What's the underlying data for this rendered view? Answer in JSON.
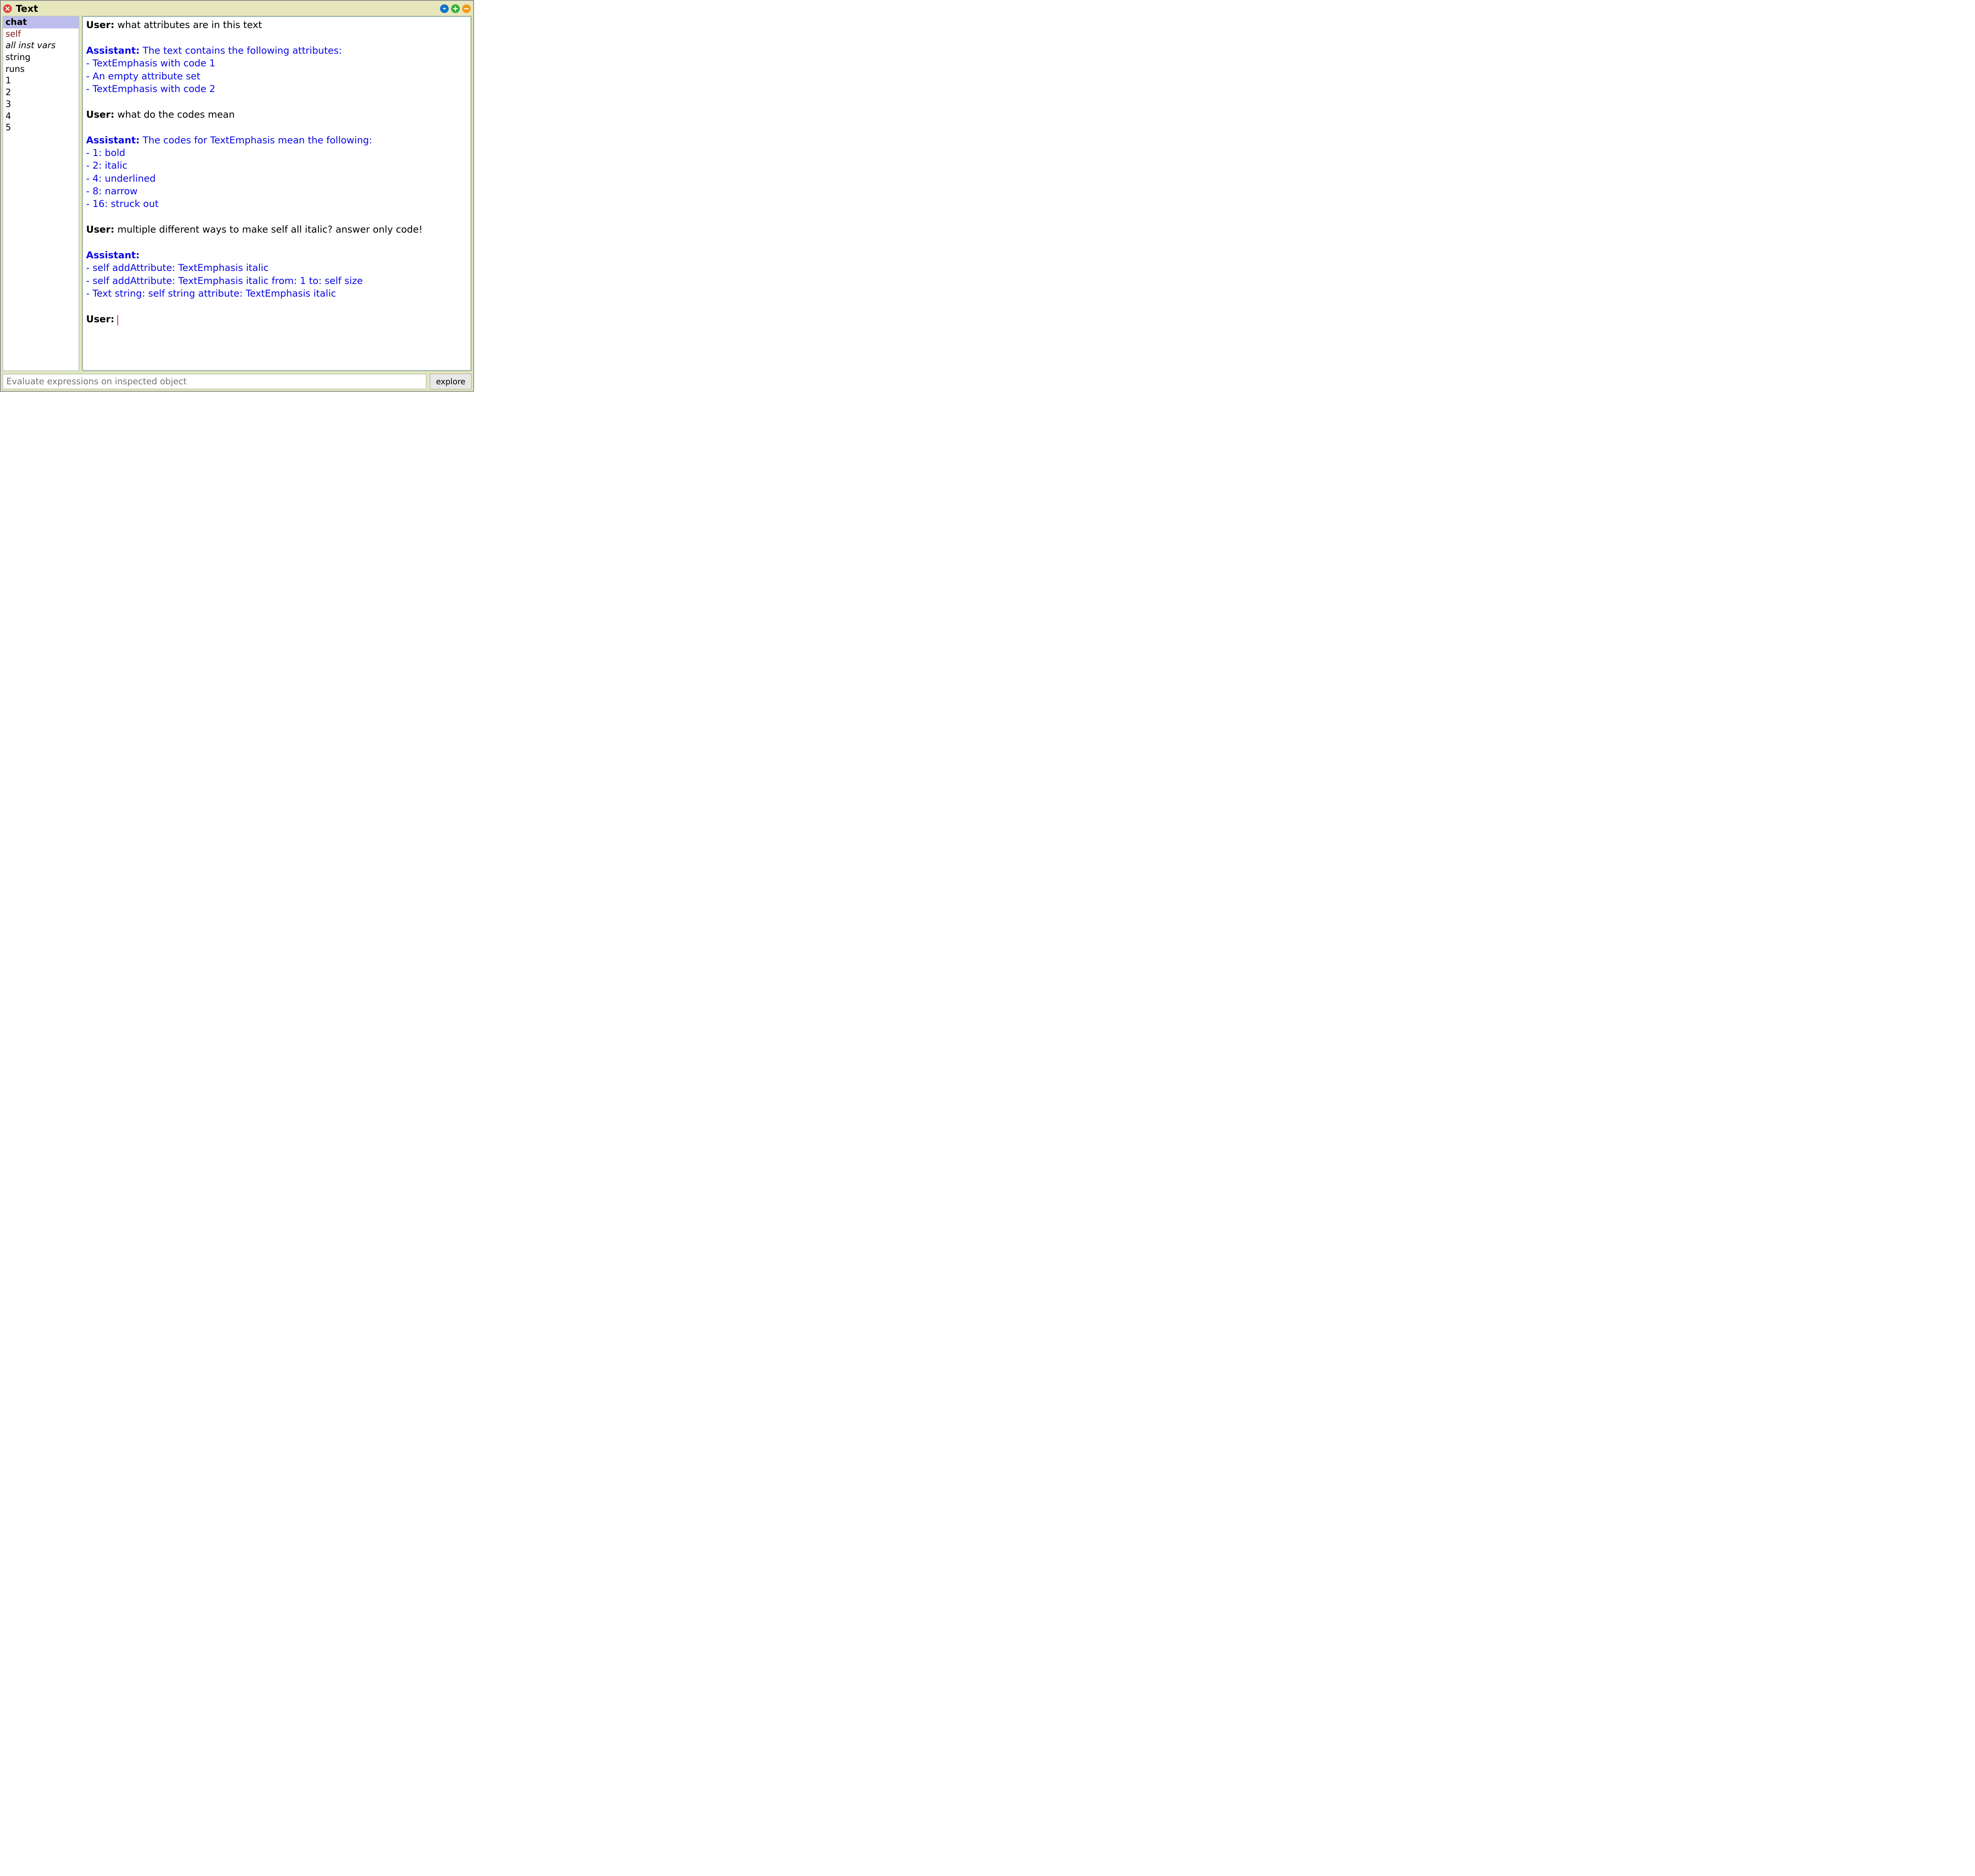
{
  "window": {
    "title": "Text"
  },
  "titlebar_icons": {
    "close": "close-icon",
    "menu": "menu-icon",
    "add": "add-icon",
    "collapse": "collapse-icon"
  },
  "sidebar": {
    "items": [
      {
        "label": "chat",
        "selected": true,
        "style": "bold"
      },
      {
        "label": "self",
        "selected": false,
        "style": "self"
      },
      {
        "label": "all inst vars",
        "selected": false,
        "style": "italic"
      },
      {
        "label": "string",
        "selected": false,
        "style": ""
      },
      {
        "label": "runs",
        "selected": false,
        "style": ""
      },
      {
        "label": "1",
        "selected": false,
        "style": ""
      },
      {
        "label": "2",
        "selected": false,
        "style": ""
      },
      {
        "label": "3",
        "selected": false,
        "style": ""
      },
      {
        "label": "4",
        "selected": false,
        "style": ""
      },
      {
        "label": "5",
        "selected": false,
        "style": ""
      }
    ]
  },
  "chat": {
    "labels": {
      "user": "User:",
      "assistant": "Assistant:"
    },
    "turns": [
      {
        "role": "user",
        "text": "what attributes are in this text"
      },
      {
        "role": "assistant",
        "text": "The text contains the following attributes:\n- TextEmphasis with code 1\n- An empty attribute set\n- TextEmphasis with code 2"
      },
      {
        "role": "user",
        "text": "what do the codes mean"
      },
      {
        "role": "assistant",
        "text": "The codes for TextEmphasis mean the following:\n- 1: bold\n- 2: italic\n- 4: underlined\n- 8: narrow\n- 16: struck out"
      },
      {
        "role": "user",
        "text": "multiple different ways to make self all italic? answer only code!"
      },
      {
        "role": "assistant",
        "text": "\n- self addAttribute: TextEmphasis italic\n- self addAttribute: TextEmphasis italic from: 1 to: self size\n- Text string: self string attribute: TextEmphasis italic"
      },
      {
        "role": "user",
        "text": "",
        "cursor": true
      }
    ]
  },
  "bottom": {
    "eval_placeholder": "Evaluate expressions on inspected object",
    "explore_label": "explore"
  },
  "colors": {
    "window_bg": "#e7e7bd",
    "pane_border": "#b9cac0",
    "chat_border": "#9fb7ae",
    "selection_bg": "#bdbded",
    "assistant_color": "#0a0ae5",
    "self_color": "#7a1f1f",
    "cursor_color": "#e53000",
    "close_color": "#d94a3a",
    "menu_color": "#1176c8",
    "add_color": "#38ae38",
    "collapse_color": "#f09a1b"
  }
}
